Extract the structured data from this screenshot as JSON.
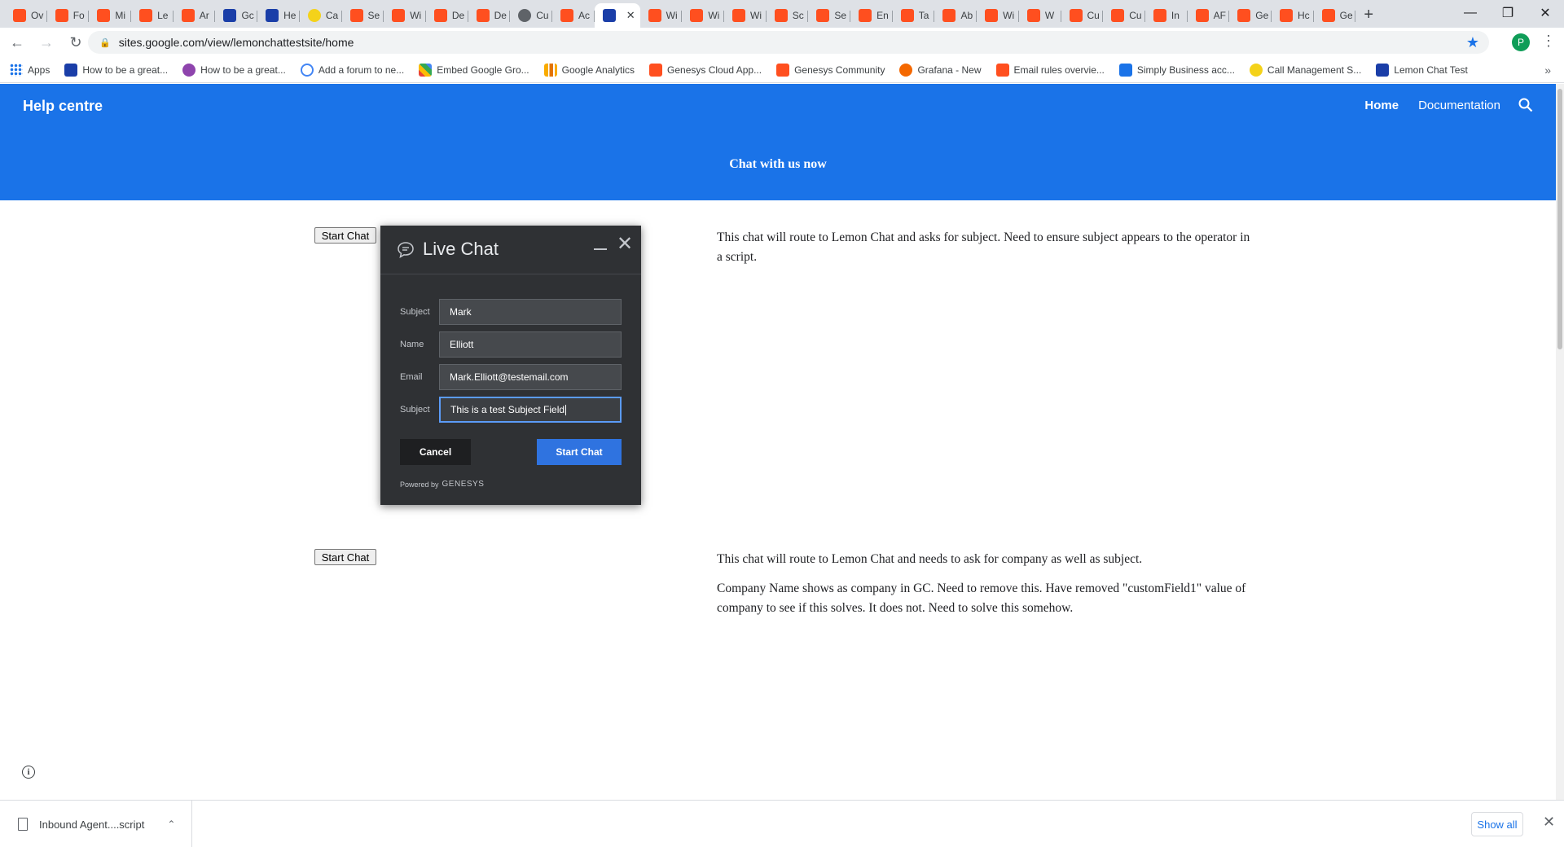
{
  "browser": {
    "tabs": [
      {
        "label": "Ov",
        "icon": "genesys-icon"
      },
      {
        "label": "Fo",
        "icon": "genesys-icon"
      },
      {
        "label": "Mi",
        "icon": "genesys-icon"
      },
      {
        "label": "Le",
        "icon": "genesys-icon"
      },
      {
        "label": "Ar",
        "icon": "genesys-icon"
      },
      {
        "label": "Gc",
        "icon": "google-sites-icon"
      },
      {
        "label": "He",
        "icon": "google-sites-icon"
      },
      {
        "label": "Ca",
        "icon": "yellow-circle-icon"
      },
      {
        "label": "Se",
        "icon": "genesys-icon"
      },
      {
        "label": "Wi",
        "icon": "genesys-icon"
      },
      {
        "label": "De",
        "icon": "genesys-icon"
      },
      {
        "label": "De",
        "icon": "genesys-icon"
      },
      {
        "label": "Cu",
        "icon": "globe-icon"
      },
      {
        "label": "Ac",
        "icon": "genesys-icon"
      },
      {
        "label": "",
        "icon": "google-sites-icon",
        "active": true
      },
      {
        "label": "Wi",
        "icon": "genesys-icon"
      },
      {
        "label": "Wi",
        "icon": "genesys-icon"
      },
      {
        "label": "Wi",
        "icon": "genesys-icon"
      },
      {
        "label": "Sc",
        "icon": "genesys-icon"
      },
      {
        "label": "Se",
        "icon": "genesys-icon"
      },
      {
        "label": "En",
        "icon": "genesys-icon"
      },
      {
        "label": "Ta",
        "icon": "genesys-icon"
      },
      {
        "label": "Ab",
        "icon": "genesys-icon"
      },
      {
        "label": "Wi",
        "icon": "genesys-icon"
      },
      {
        "label": "W",
        "icon": "genesys-icon"
      },
      {
        "label": "Cu",
        "icon": "genesys-icon"
      },
      {
        "label": "Cu",
        "icon": "genesys-icon"
      },
      {
        "label": "In",
        "icon": "genesys-icon"
      },
      {
        "label": "AF",
        "icon": "genesys-icon"
      },
      {
        "label": "Ge",
        "icon": "genesys-icon"
      },
      {
        "label": "Hc",
        "icon": "genesys-icon"
      },
      {
        "label": "Ge",
        "icon": "genesys-icon"
      }
    ],
    "url": "sites.google.com/view/lemonchattestsite/home",
    "profile_initial": "P",
    "bookmarks": [
      {
        "label": "Apps",
        "icon": "grid"
      },
      {
        "label": "How to be a great...",
        "icon": "site"
      },
      {
        "label": "How to be a great...",
        "icon": "purple"
      },
      {
        "label": "Add a forum to ne...",
        "icon": "g"
      },
      {
        "label": "Embed Google Gro...",
        "icon": "multi"
      },
      {
        "label": "Google Analytics",
        "icon": "chart"
      },
      {
        "label": "Genesys Cloud App...",
        "icon": "orange"
      },
      {
        "label": "Genesys Community",
        "icon": "orange"
      },
      {
        "label": "Grafana - New",
        "icon": "grafana"
      },
      {
        "label": "Email rules overvie...",
        "icon": "orange"
      },
      {
        "label": "Simply Business acc...",
        "icon": "sb"
      },
      {
        "label": "Call Management S...",
        "icon": "yellow"
      },
      {
        "label": "Lemon Chat Test",
        "icon": "site"
      }
    ]
  },
  "site": {
    "title": "Help centre",
    "nav": [
      {
        "label": "Home",
        "current": true
      },
      {
        "label": "Documentation",
        "current": false
      }
    ],
    "hero_text": "Chat with us now",
    "sections": [
      {
        "button_label": "Start Chat",
        "paragraphs": [
          "This chat will route to Lemon Chat and asks for subject. Need to ensure subject appears to the operator in a script."
        ]
      },
      {
        "button_label": "Start Chat",
        "paragraphs": [
          "This chat will route to Lemon Chat and needs to ask for company as well as subject.",
          "Company Name shows as company in GC. Need to remove this. Have removed \"customField1\" value of company to see if this solves. It does not. Need to solve this somehow."
        ]
      }
    ]
  },
  "chat_widget": {
    "title": "Live Chat",
    "fields": [
      {
        "label": "Subject",
        "value": "Mark"
      },
      {
        "label": "Name",
        "value": "Elliott"
      },
      {
        "label": "Email",
        "value": "Mark.Elliott@testemail.com"
      },
      {
        "label": "Subject",
        "value": "This is a test Subject Field",
        "focused": true
      }
    ],
    "cancel_label": "Cancel",
    "start_label": "Start Chat",
    "powered_by": "Powered by",
    "brand": "GENESYS"
  },
  "download_shelf": {
    "file_name": "Inbound Agent....script",
    "show_all_label": "Show all"
  },
  "colors": {
    "header_blue": "#1a73e8",
    "chat_bg": "#2f3134",
    "chat_start_button": "#2f73e0",
    "genesys_orange": "#ff4f1f"
  }
}
